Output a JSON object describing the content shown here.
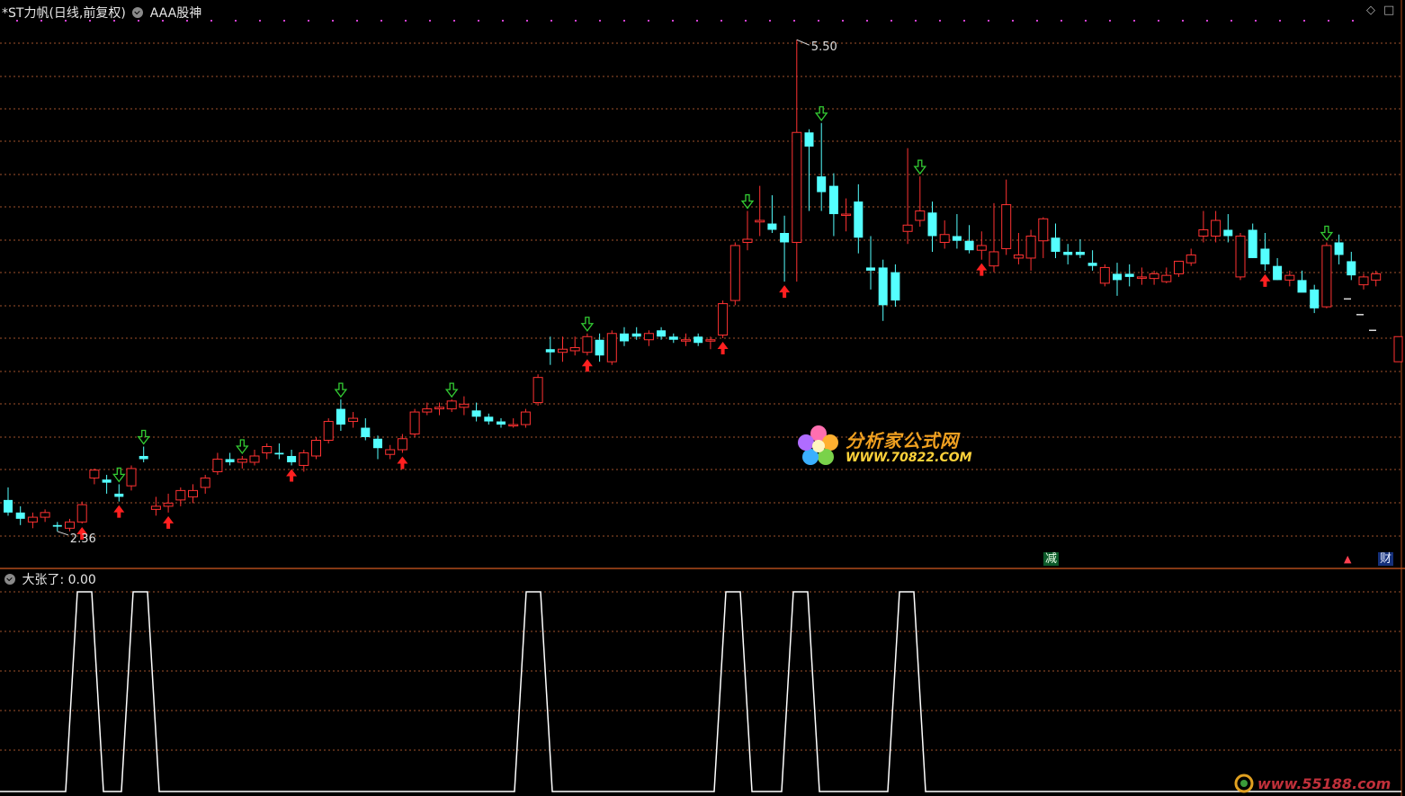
{
  "header": {
    "stock_title": "*ST力帆(日线,前复权)",
    "indicator_name": "AAA股神"
  },
  "sub_panel": {
    "label": "大张了",
    "value_text": ": 0.00"
  },
  "annotations": {
    "high_label": "5.50",
    "low_label": "2.36",
    "badge_jian": "减",
    "badge_cai": "财"
  },
  "watermarks": {
    "cn": "分析家公式网",
    "url": "WWW.70822.COM",
    "url2": "www.55188.com"
  },
  "colors": {
    "up": "#ff3232",
    "down": "#54ffff",
    "grid": "#a0522d",
    "signal_buy": "#ff2020",
    "signal_sell": "#33cc33",
    "line": "#ffffff"
  },
  "chart_data": [
    {
      "type": "candlestick",
      "title": "*ST力帆(日线,前复权)",
      "ylim": [
        2.25,
        5.6
      ],
      "annotations": [
        {
          "text": "5.50",
          "kind": "max"
        },
        {
          "text": "2.36",
          "kind": "min"
        }
      ],
      "candles": [
        [
          2.56,
          2.64,
          2.46,
          2.48
        ],
        [
          2.48,
          2.52,
          2.4,
          2.44
        ],
        [
          2.42,
          2.48,
          2.38,
          2.45
        ],
        [
          2.45,
          2.5,
          2.42,
          2.48
        ],
        [
          2.4,
          2.42,
          2.36,
          2.39
        ],
        [
          2.38,
          2.44,
          2.36,
          2.42
        ],
        [
          2.42,
          2.55,
          2.41,
          2.53
        ],
        [
          2.7,
          2.76,
          2.66,
          2.75
        ],
        [
          2.69,
          2.72,
          2.6,
          2.67
        ],
        [
          2.6,
          2.66,
          2.55,
          2.58
        ],
        [
          2.65,
          2.78,
          2.62,
          2.76
        ],
        [
          2.84,
          2.9,
          2.8,
          2.82
        ],
        [
          2.5,
          2.58,
          2.46,
          2.52
        ],
        [
          2.52,
          2.6,
          2.48,
          2.54
        ],
        [
          2.56,
          2.64,
          2.52,
          2.62
        ],
        [
          2.58,
          2.66,
          2.54,
          2.62
        ],
        [
          2.64,
          2.72,
          2.6,
          2.7
        ],
        [
          2.74,
          2.86,
          2.72,
          2.82
        ],
        [
          2.82,
          2.86,
          2.78,
          2.8
        ],
        [
          2.8,
          2.84,
          2.76,
          2.82
        ],
        [
          2.8,
          2.88,
          2.78,
          2.84
        ],
        [
          2.86,
          2.92,
          2.82,
          2.9
        ],
        [
          2.86,
          2.92,
          2.82,
          2.85
        ],
        [
          2.84,
          2.88,
          2.78,
          2.8
        ],
        [
          2.78,
          2.88,
          2.74,
          2.86
        ],
        [
          2.84,
          2.96,
          2.82,
          2.94
        ],
        [
          2.94,
          3.08,
          2.92,
          3.06
        ],
        [
          3.14,
          3.2,
          3.0,
          3.04
        ],
        [
          3.06,
          3.12,
          3.02,
          3.08
        ],
        [
          3.02,
          3.08,
          2.94,
          2.96
        ],
        [
          2.95,
          2.97,
          2.82,
          2.89
        ],
        [
          2.85,
          2.91,
          2.82,
          2.88
        ],
        [
          2.88,
          2.98,
          2.86,
          2.95
        ],
        [
          2.98,
          3.14,
          2.96,
          3.12
        ],
        [
          3.12,
          3.18,
          3.1,
          3.14
        ],
        [
          3.14,
          3.18,
          3.1,
          3.15
        ],
        [
          3.14,
          3.2,
          3.12,
          3.19
        ],
        [
          3.15,
          3.22,
          3.1,
          3.17
        ],
        [
          3.13,
          3.18,
          3.06,
          3.09
        ],
        [
          3.09,
          3.11,
          3.04,
          3.06
        ],
        [
          3.06,
          3.08,
          3.02,
          3.04
        ],
        [
          3.04,
          3.08,
          3.02,
          3.04
        ],
        [
          3.04,
          3.14,
          3.02,
          3.12
        ],
        [
          3.18,
          3.36,
          3.16,
          3.34
        ],
        [
          3.52,
          3.6,
          3.42,
          3.5
        ],
        [
          3.5,
          3.6,
          3.44,
          3.52
        ],
        [
          3.51,
          3.6,
          3.48,
          3.53
        ],
        [
          3.5,
          3.62,
          3.48,
          3.6
        ],
        [
          3.58,
          3.62,
          3.44,
          3.48
        ],
        [
          3.44,
          3.64,
          3.42,
          3.62
        ],
        [
          3.62,
          3.66,
          3.54,
          3.57
        ],
        [
          3.62,
          3.66,
          3.58,
          3.6
        ],
        [
          3.58,
          3.64,
          3.54,
          3.62
        ],
        [
          3.64,
          3.66,
          3.58,
          3.6
        ],
        [
          3.6,
          3.62,
          3.56,
          3.58
        ],
        [
          3.58,
          3.62,
          3.54,
          3.58
        ],
        [
          3.6,
          3.62,
          3.54,
          3.56
        ],
        [
          3.58,
          3.6,
          3.52,
          3.58
        ],
        [
          3.61,
          3.83,
          3.59,
          3.81
        ],
        [
          3.83,
          4.2,
          3.8,
          4.18
        ],
        [
          4.2,
          4.4,
          4.15,
          4.22
        ],
        [
          4.33,
          4.56,
          4.24,
          4.34
        ],
        [
          4.32,
          4.5,
          4.26,
          4.28
        ],
        [
          4.26,
          4.37,
          3.95,
          4.2
        ],
        [
          4.2,
          5.49,
          3.95,
          4.9
        ],
        [
          4.9,
          4.92,
          4.4,
          4.81
        ],
        [
          4.62,
          4.96,
          4.4,
          4.52
        ],
        [
          4.56,
          4.64,
          4.24,
          4.38
        ],
        [
          4.38,
          4.48,
          4.27,
          4.38
        ],
        [
          4.46,
          4.57,
          4.13,
          4.23
        ],
        [
          4.04,
          4.24,
          3.9,
          4.02
        ],
        [
          4.04,
          4.09,
          3.7,
          3.8
        ],
        [
          4.01,
          4.06,
          3.79,
          3.83
        ],
        [
          4.27,
          4.8,
          4.19,
          4.31
        ],
        [
          4.34,
          4.62,
          4.3,
          4.4
        ],
        [
          4.39,
          4.46,
          4.14,
          4.24
        ],
        [
          4.2,
          4.34,
          4.16,
          4.25
        ],
        [
          4.24,
          4.38,
          4.16,
          4.21
        ],
        [
          4.21,
          4.31,
          4.13,
          4.15
        ],
        [
          4.15,
          4.27,
          4.09,
          4.18
        ],
        [
          4.05,
          4.45,
          4.01,
          4.14
        ],
        [
          4.16,
          4.6,
          4.12,
          4.44
        ],
        [
          4.1,
          4.26,
          4.06,
          4.12
        ],
        [
          4.1,
          4.28,
          4.02,
          4.24
        ],
        [
          4.21,
          4.36,
          4.1,
          4.35
        ],
        [
          4.23,
          4.32,
          4.1,
          4.14
        ],
        [
          4.14,
          4.19,
          4.06,
          4.12
        ],
        [
          4.14,
          4.22,
          4.1,
          4.12
        ],
        [
          4.07,
          4.15,
          4.02,
          4.05
        ],
        [
          3.94,
          4.06,
          3.92,
          4.04
        ],
        [
          4.0,
          4.07,
          3.86,
          3.96
        ],
        [
          4.0,
          4.06,
          3.92,
          3.98
        ],
        [
          3.98,
          4.04,
          3.93,
          3.98
        ],
        [
          3.97,
          4.02,
          3.93,
          4.0
        ],
        [
          3.95,
          4.04,
          3.94,
          3.99
        ],
        [
          4.0,
          4.07,
          3.98,
          4.08
        ],
        [
          4.07,
          4.16,
          4.05,
          4.12
        ],
        [
          4.24,
          4.4,
          4.2,
          4.28
        ],
        [
          4.24,
          4.4,
          4.2,
          4.34
        ],
        [
          4.28,
          4.38,
          4.2,
          4.24
        ],
        [
          3.98,
          4.26,
          3.96,
          4.24
        ],
        [
          4.28,
          4.32,
          4.1,
          4.1
        ],
        [
          4.16,
          4.26,
          4.02,
          4.06
        ],
        [
          4.05,
          4.1,
          3.96,
          3.96
        ],
        [
          3.96,
          4.02,
          3.92,
          3.99
        ],
        [
          3.96,
          4.02,
          3.9,
          3.88
        ],
        [
          3.9,
          3.93,
          3.75,
          3.78
        ],
        [
          3.79,
          4.2,
          3.78,
          4.18
        ],
        [
          4.2,
          4.25,
          4.06,
          4.12
        ],
        [
          4.08,
          4.14,
          3.96,
          3.99
        ],
        [
          3.93,
          4.0,
          3.9,
          3.98
        ],
        [
          3.96,
          4.02,
          3.92,
          4.0
        ]
      ],
      "signals_buy_index": [
        6,
        9,
        13,
        23,
        32,
        47,
        58,
        63,
        79,
        102
      ],
      "signals_sell_index": [
        9,
        11,
        19,
        27,
        36,
        47,
        60,
        66,
        74,
        107
      ],
      "right_edge_marks": [
        3.84,
        3.74,
        3.64
      ],
      "right_edge_candle": [
        3.44,
        3.6,
        3.44,
        3.6
      ]
    },
    {
      "type": "line",
      "title": "大张了",
      "ylim": [
        0,
        1
      ],
      "peaks_x_centers": [
        94,
        156,
        593,
        815,
        890,
        1008
      ]
    }
  ]
}
